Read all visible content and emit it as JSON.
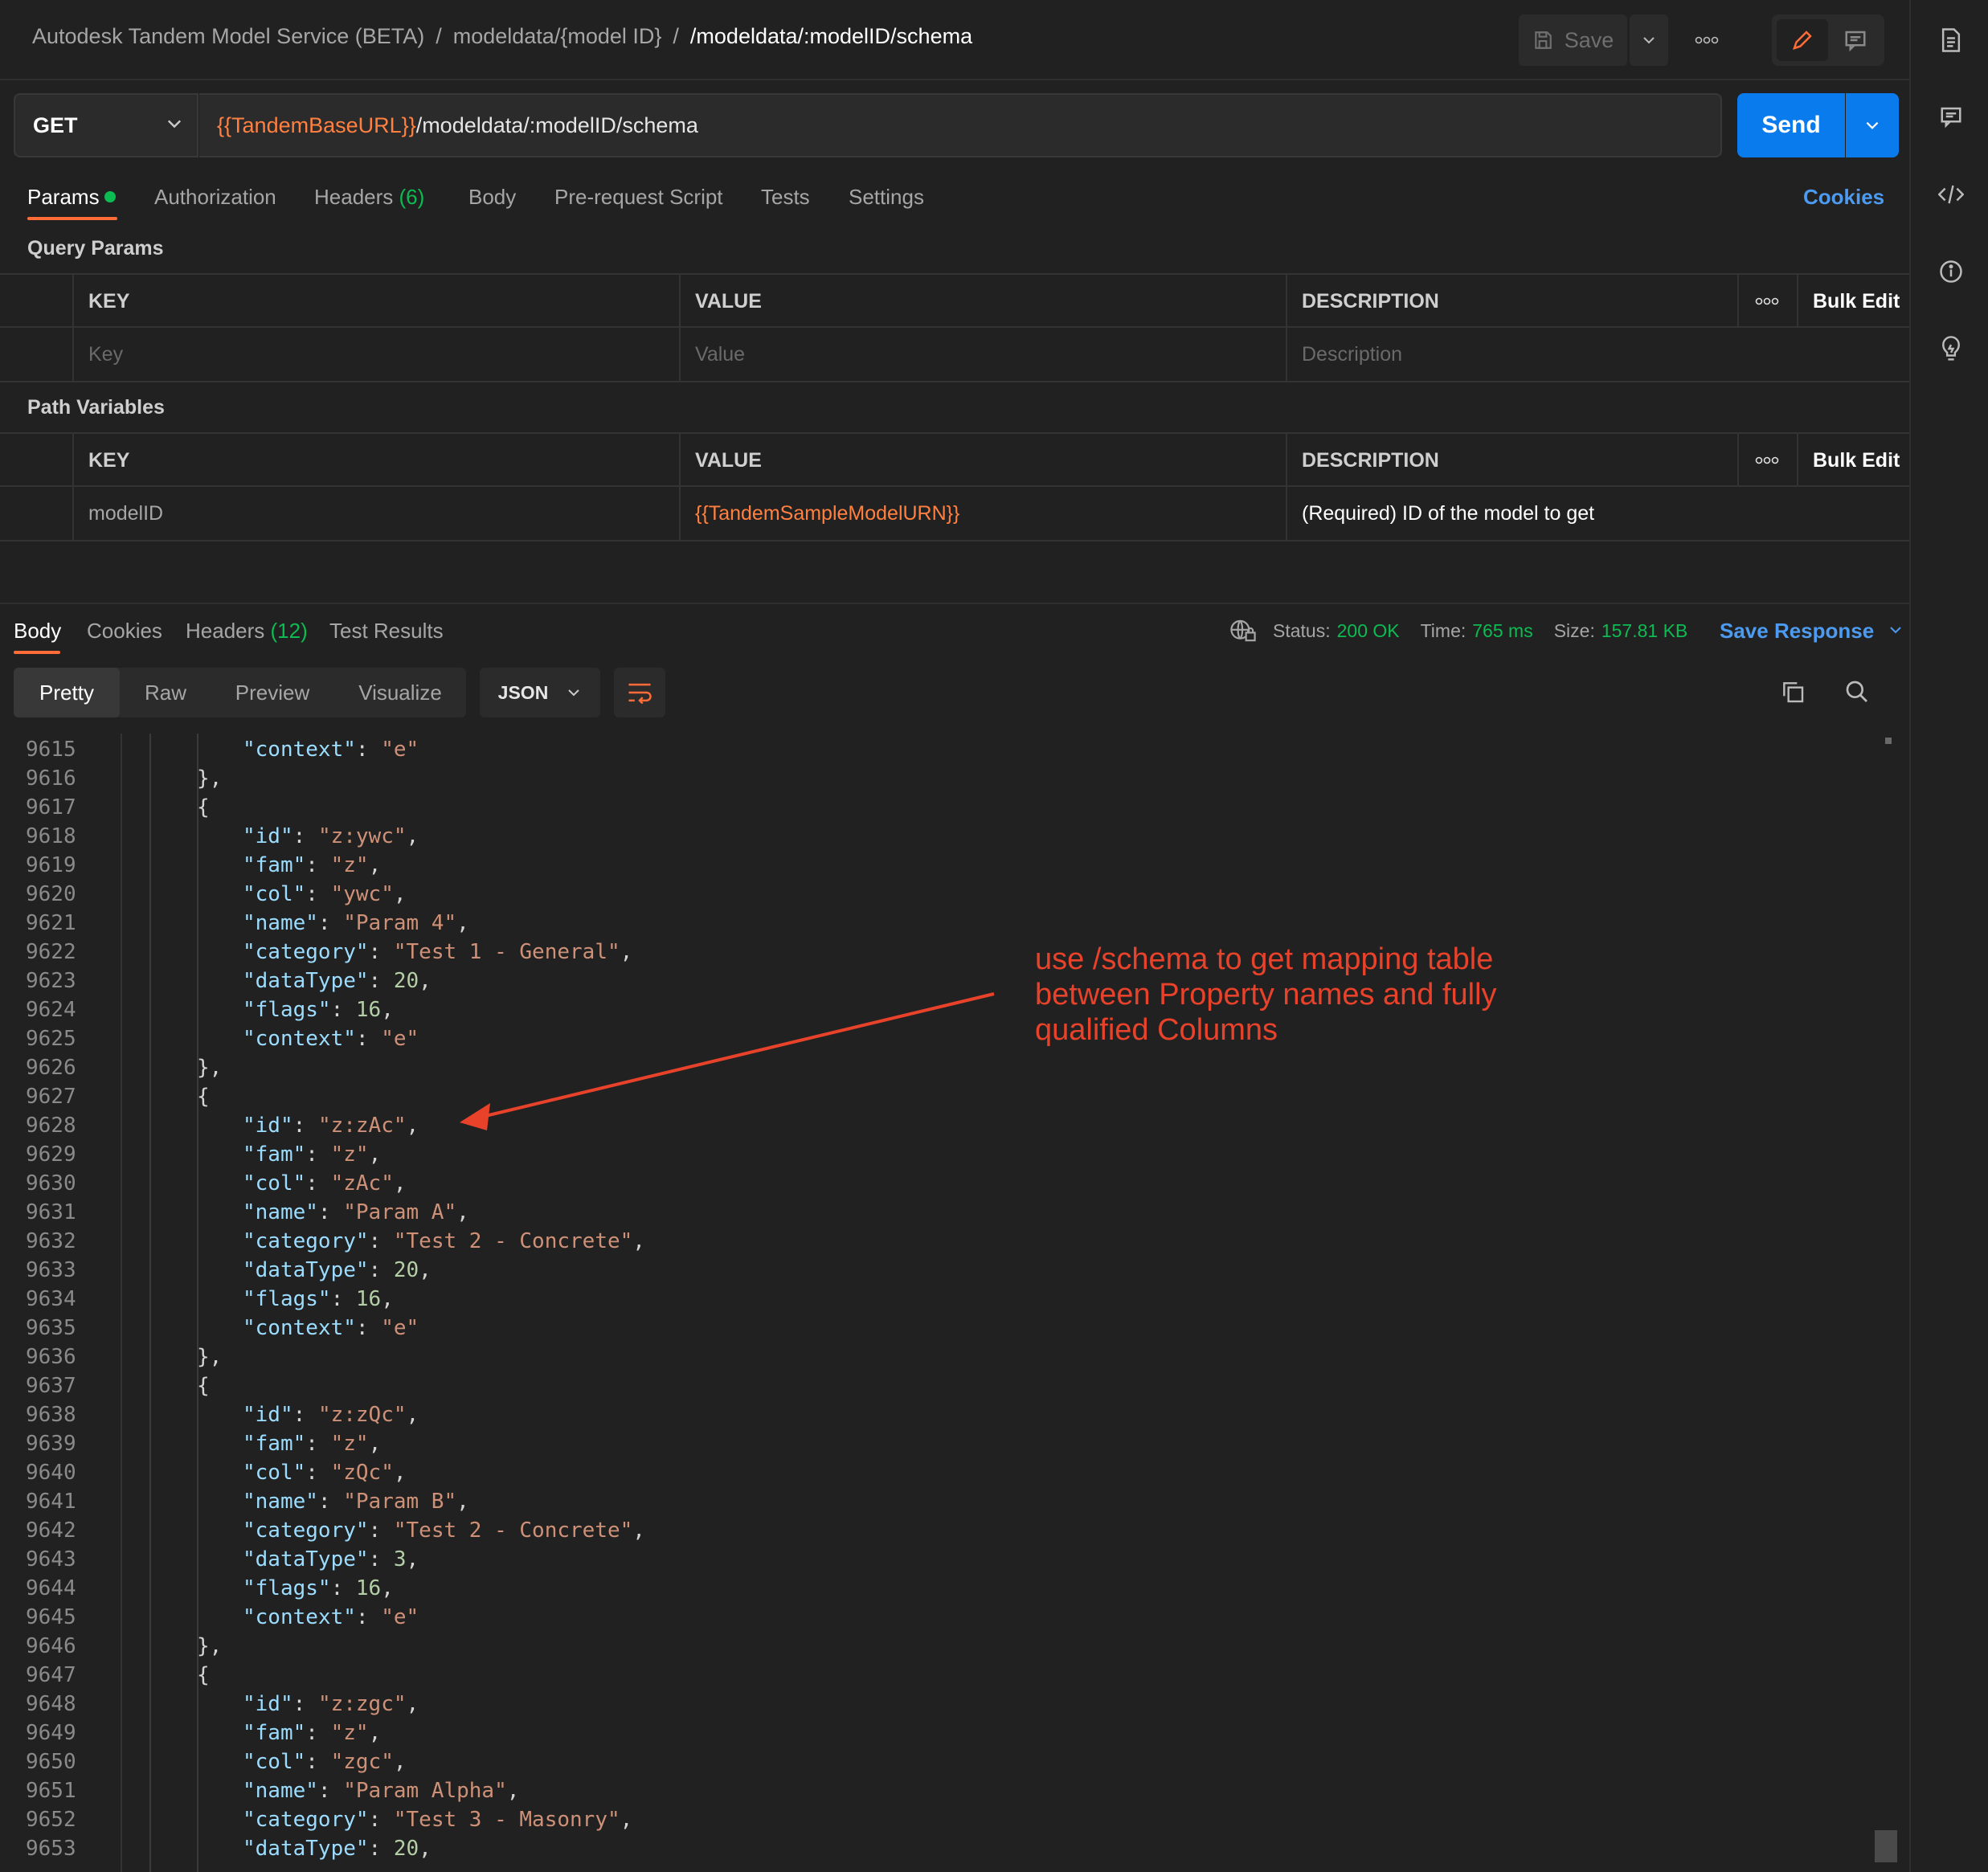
{
  "header": {
    "breadcrumb": [
      "Autodesk Tandem Model Service (BETA)",
      "modeldata/{model ID}",
      "/modeldata/:modelID/schema"
    ],
    "save_label": "Save"
  },
  "request": {
    "method": "GET",
    "url_var": "{{TandemBaseURL}}",
    "url_path": "/modeldata/:modelID/schema",
    "send_label": "Send"
  },
  "tabs": {
    "params": "Params",
    "authorization": "Authorization",
    "headers": "Headers",
    "headers_count": "(6)",
    "body": "Body",
    "prerequest": "Pre-request Script",
    "tests": "Tests",
    "settings": "Settings",
    "cookies": "Cookies"
  },
  "query_params": {
    "title": "Query Params",
    "columns": [
      "KEY",
      "VALUE",
      "DESCRIPTION"
    ],
    "bulk_edit": "Bulk Edit",
    "placeholders": {
      "key": "Key",
      "value": "Value",
      "description": "Description"
    }
  },
  "path_variables": {
    "title": "Path Variables",
    "columns": [
      "KEY",
      "VALUE",
      "DESCRIPTION"
    ],
    "bulk_edit": "Bulk Edit",
    "rows": [
      {
        "key": "modelID",
        "value": "{{TandemSampleModelURN}}",
        "description": "(Required) ID of the model to get"
      }
    ]
  },
  "response": {
    "tabs": {
      "body": "Body",
      "cookies": "Cookies",
      "headers": "Headers",
      "headers_count": "(12)",
      "test_results": "Test Results"
    },
    "status_label": "Status:",
    "status_value": "200 OK",
    "time_label": "Time:",
    "time_value": "765 ms",
    "size_label": "Size:",
    "size_value": "157.81 KB",
    "save_response": "Save Response",
    "views": [
      "Pretty",
      "Raw",
      "Preview",
      "Visualize"
    ],
    "format": "JSON"
  },
  "code": {
    "first_line": 9615,
    "lines": [
      [
        3,
        "k:\"context\"",
        "p:: ",
        "s:\"e\""
      ],
      [
        2,
        "p:},"
      ],
      [
        2,
        "p:{"
      ],
      [
        3,
        "k:\"id\"",
        "p:: ",
        "s:\"z:ywc\"",
        "p:,"
      ],
      [
        3,
        "k:\"fam\"",
        "p:: ",
        "s:\"z\"",
        "p:,"
      ],
      [
        3,
        "k:\"col\"",
        "p:: ",
        "s:\"ywc\"",
        "p:,"
      ],
      [
        3,
        "k:\"name\"",
        "p:: ",
        "s:\"Param 4\"",
        "p:,"
      ],
      [
        3,
        "k:\"category\"",
        "p:: ",
        "s:\"Test 1 - General\"",
        "p:,"
      ],
      [
        3,
        "k:\"dataType\"",
        "p:: ",
        "n:20",
        "p:,"
      ],
      [
        3,
        "k:\"flags\"",
        "p:: ",
        "n:16",
        "p:,"
      ],
      [
        3,
        "k:\"context\"",
        "p:: ",
        "s:\"e\""
      ],
      [
        2,
        "p:},"
      ],
      [
        2,
        "p:{"
      ],
      [
        3,
        "k:\"id\"",
        "p:: ",
        "s:\"z:zAc\"",
        "p:,"
      ],
      [
        3,
        "k:\"fam\"",
        "p:: ",
        "s:\"z\"",
        "p:,"
      ],
      [
        3,
        "k:\"col\"",
        "p:: ",
        "s:\"zAc\"",
        "p:,"
      ],
      [
        3,
        "k:\"name\"",
        "p:: ",
        "s:\"Param A\"",
        "p:,"
      ],
      [
        3,
        "k:\"category\"",
        "p:: ",
        "s:\"Test 2 - Concrete\"",
        "p:,"
      ],
      [
        3,
        "k:\"dataType\"",
        "p:: ",
        "n:20",
        "p:,"
      ],
      [
        3,
        "k:\"flags\"",
        "p:: ",
        "n:16",
        "p:,"
      ],
      [
        3,
        "k:\"context\"",
        "p:: ",
        "s:\"e\""
      ],
      [
        2,
        "p:},"
      ],
      [
        2,
        "p:{"
      ],
      [
        3,
        "k:\"id\"",
        "p:: ",
        "s:\"z:zQc\"",
        "p:,"
      ],
      [
        3,
        "k:\"fam\"",
        "p:: ",
        "s:\"z\"",
        "p:,"
      ],
      [
        3,
        "k:\"col\"",
        "p:: ",
        "s:\"zQc\"",
        "p:,"
      ],
      [
        3,
        "k:\"name\"",
        "p:: ",
        "s:\"Param B\"",
        "p:,"
      ],
      [
        3,
        "k:\"category\"",
        "p:: ",
        "s:\"Test 2 - Concrete\"",
        "p:,"
      ],
      [
        3,
        "k:\"dataType\"",
        "p:: ",
        "n:3",
        "p:,"
      ],
      [
        3,
        "k:\"flags\"",
        "p:: ",
        "n:16",
        "p:,"
      ],
      [
        3,
        "k:\"context\"",
        "p:: ",
        "s:\"e\""
      ],
      [
        2,
        "p:},"
      ],
      [
        2,
        "p:{"
      ],
      [
        3,
        "k:\"id\"",
        "p:: ",
        "s:\"z:zgc\"",
        "p:,"
      ],
      [
        3,
        "k:\"fam\"",
        "p:: ",
        "s:\"z\"",
        "p:,"
      ],
      [
        3,
        "k:\"col\"",
        "p:: ",
        "s:\"zgc\"",
        "p:,"
      ],
      [
        3,
        "k:\"name\"",
        "p:: ",
        "s:\"Param Alpha\"",
        "p:,"
      ],
      [
        3,
        "k:\"category\"",
        "p:: ",
        "s:\"Test 3 - Masonry\"",
        "p:,"
      ],
      [
        3,
        "k:\"dataType\"",
        "p:: ",
        "n:20",
        "p:,"
      ]
    ]
  },
  "annotation": {
    "text": "use /schema to get mapping table between Property names and fully qualified Columns",
    "color": "#e8422b"
  },
  "colors": {
    "accent": "#ff6c37",
    "send": "#097bed",
    "link": "#4d9bf0",
    "ok": "#0cbb52"
  }
}
